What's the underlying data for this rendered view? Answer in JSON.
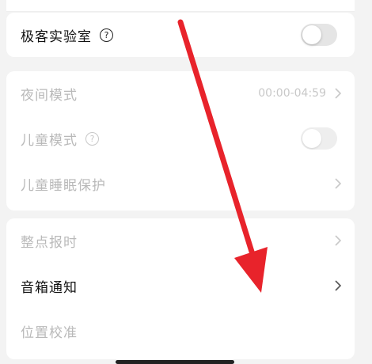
{
  "settings": {
    "lab": {
      "label": "极客实验室",
      "help_icon": "?",
      "toggle": {
        "on": false
      }
    },
    "night_mode": {
      "label": "夜间模式",
      "value": "00:00-04:59",
      "disabled": true
    },
    "child_mode": {
      "label": "儿童模式",
      "help_icon": "?",
      "toggle": {
        "on": false
      },
      "disabled": true
    },
    "child_sleep": {
      "label": "儿童睡眠保护",
      "disabled": true
    },
    "hourly_chime": {
      "label": "整点报时",
      "disabled": true
    },
    "speaker_notice": {
      "label": "音箱通知"
    },
    "position_calibration": {
      "label": "位置校准",
      "disabled": true
    }
  },
  "annotation": {
    "color": "#e8232b"
  },
  "icons": [
    "help-icon",
    "chevron-right-icon",
    "toggle-switch"
  ]
}
